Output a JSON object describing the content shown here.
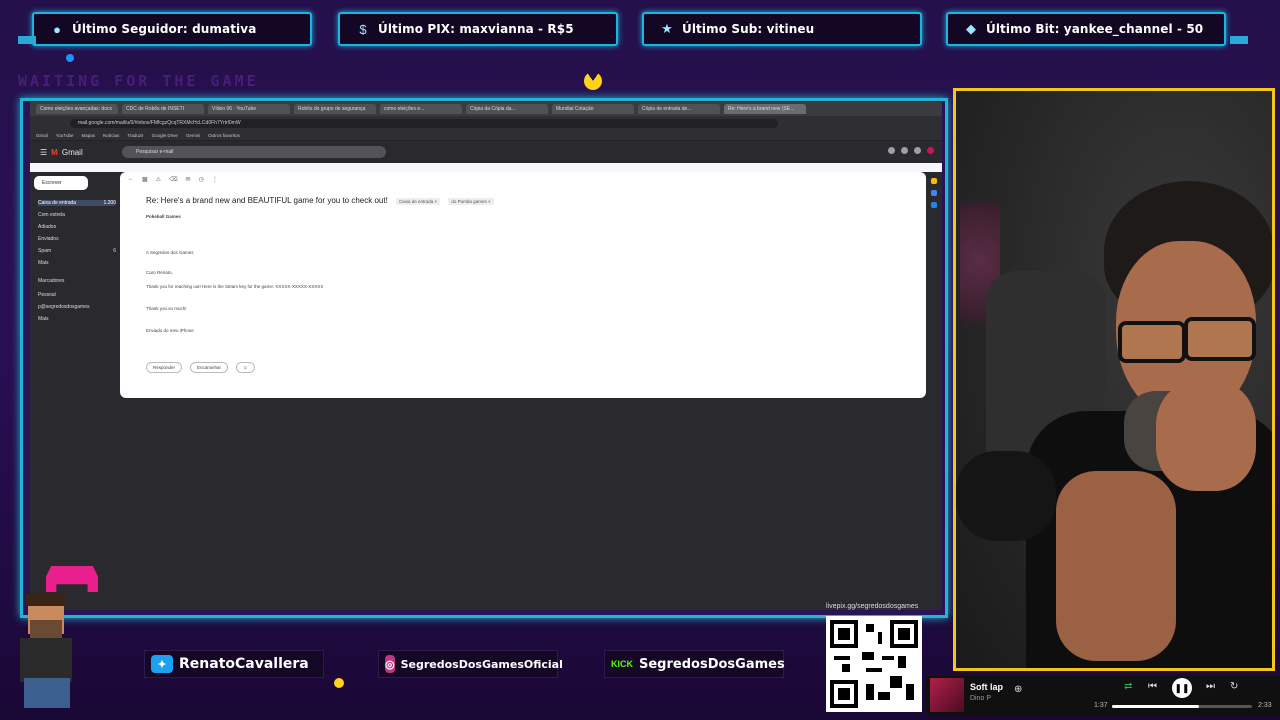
{
  "alerts": [
    {
      "icon": "user-icon",
      "text": "Último Seguidor: dumativa"
    },
    {
      "icon": "dollar-icon",
      "text": "Último PIX: maxvianna - R$5"
    },
    {
      "icon": "star-icon",
      "text": "Último Sub: vitineu"
    },
    {
      "icon": "diamond-icon",
      "text": "Último Bit: yankee_channel - 50"
    }
  ],
  "overlay": {
    "waiting_text": "WAITING FOR THE GAME"
  },
  "browser": {
    "tabs": [
      "Como eleições avançadas: docs",
      "CDC de Robôs de INSETI",
      "Vídeo 06 · YouTube",
      "Robôs do grupo de segurança",
      "como eleições e...",
      "Cópia da Cópia da...",
      "Mundial Cotação",
      "Cópia de entrada de...",
      "Re: Here's a brand new (SE..."
    ],
    "address": "mail.google.com/mail/u/0/#inbox/FMfcgzQcqTRXMcHcLCd0Fh7Yrtrl0mW",
    "bookmarks": [
      "Gmail",
      "YouTube",
      "Mapas",
      "Notícias",
      "Traduzir",
      "Google Drive",
      "Gemini",
      "Outros favoritos"
    ],
    "gmail": {
      "brand": "Gmail",
      "search_placeholder": "Pesquisar e-mail",
      "compose": "Escrever",
      "sidebar": [
        {
          "label": "Caixa de entrada",
          "count": "1.200"
        },
        {
          "label": "Com estrela",
          "count": ""
        },
        {
          "label": "Adiados",
          "count": ""
        },
        {
          "label": "Enviados",
          "count": ""
        },
        {
          "label": "Spam",
          "count": "6"
        },
        {
          "label": "Mais",
          "count": ""
        }
      ],
      "labels_header": "Marcadores",
      "labels": [
        "Pessoal",
        "p@segredosdosgames",
        "Mais"
      ],
      "subject": "Re: Here's a brand new and BEAUTIFUL game for you to check out!",
      "chips": [
        "Caixa de entrada ×",
        "do Pumba games ×"
      ],
      "from": "Pokeball Games",
      "lines": [
        "A Segredos dos Games",
        "Caro Renato,",
        "Thank you for reaching out! Here is the Steam key for the game: XXXXX-XXXXX-XXXXX",
        "Thank you so much!",
        "Enviado do meu iPhone"
      ],
      "reply": "Responder",
      "forward": "Encaminhar"
    }
  },
  "socials": [
    {
      "icon": "twitter-icon",
      "handle": "RenatoCavallera",
      "color": "#1da1f2"
    },
    {
      "icon": "instagram-icon",
      "handle": "SegredosDosGamesOficial",
      "color": "#c13584"
    },
    {
      "icon": "kick-icon",
      "badge": "KICK",
      "handle": "SegredosDosGames",
      "color": "#53fc18"
    }
  ],
  "qr_caption": "livepix.gg/segredosdosgames",
  "player": {
    "title": "Soft lap",
    "artist": "Dino P",
    "time_current": "1:37",
    "time_total": "2:33",
    "progress": 0.62
  }
}
